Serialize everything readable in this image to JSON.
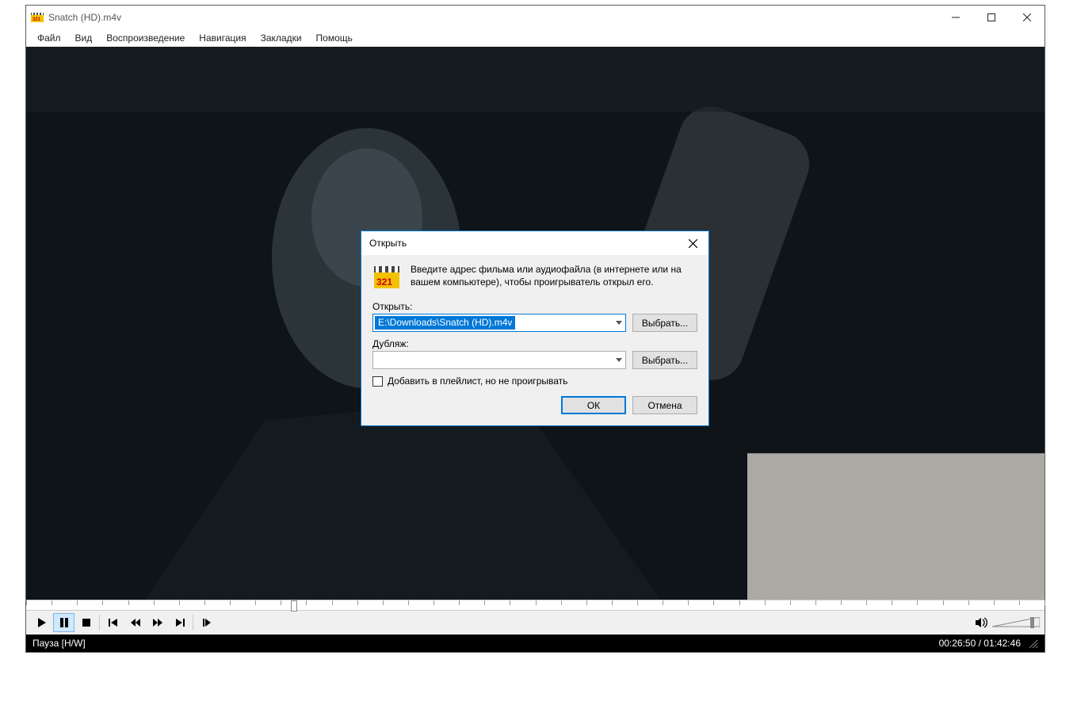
{
  "window": {
    "title": "Snatch (HD).m4v"
  },
  "menu": {
    "items": [
      "Файл",
      "Вид",
      "Воспроизведение",
      "Навигация",
      "Закладки",
      "Помощь"
    ]
  },
  "status": {
    "left": "Пауза [H/W]",
    "time": "00:26:50 / 01:42:46"
  },
  "seek": {
    "position_pct": 26
  },
  "dialog": {
    "title": "Открыть",
    "instruction": "Введите адрес фильма или аудиофайла (в интернете или на вашем компьютере), чтобы проигрыватель открыл его.",
    "open_label": "Открыть:",
    "open_value": "E:\\Downloads\\Snatch (HD).m4v",
    "browse_label": "Выбрать...",
    "dub_label": "Дубляж:",
    "dub_value": "",
    "checkbox_label": "Добавить в плейлист, но не проигрывать",
    "ok_label": "ОК",
    "cancel_label": "Отмена"
  }
}
